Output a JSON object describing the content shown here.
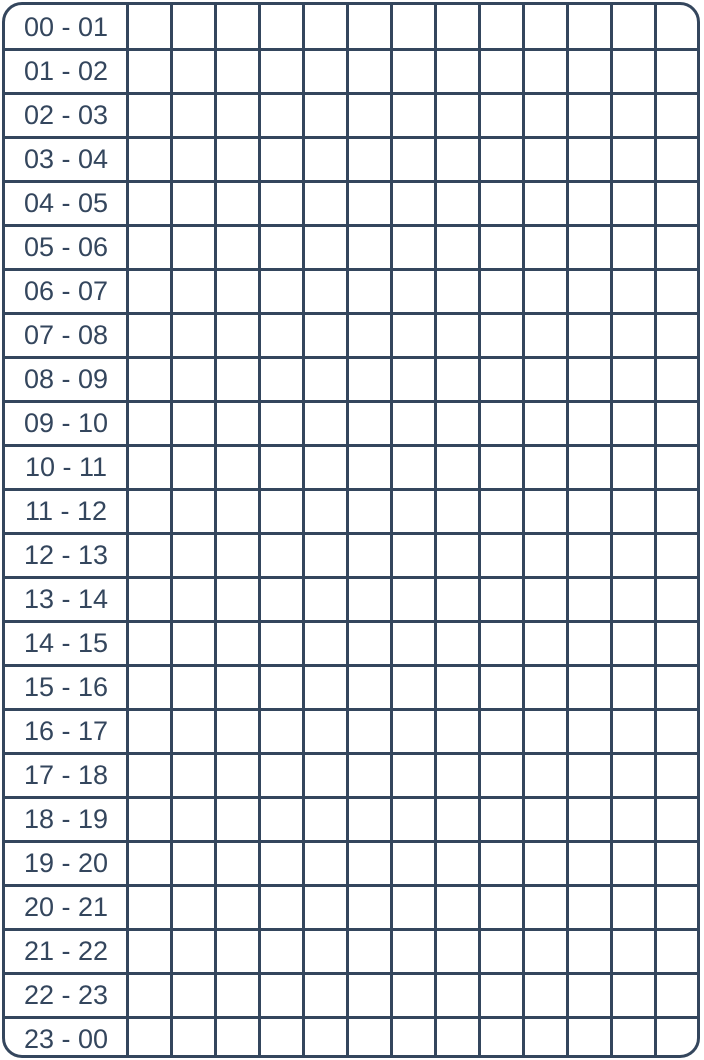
{
  "tracker": {
    "grid_color": "#34465d",
    "hours": [
      {
        "label": "00 - 01"
      },
      {
        "label": "01 - 02"
      },
      {
        "label": "02 - 03"
      },
      {
        "label": "03 - 04"
      },
      {
        "label": "04 - 05"
      },
      {
        "label": "05 - 06"
      },
      {
        "label": "06 - 07"
      },
      {
        "label": "07 - 08"
      },
      {
        "label": "08 - 09"
      },
      {
        "label": "09 - 10"
      },
      {
        "label": "10 - 11"
      },
      {
        "label": "11 - 12"
      },
      {
        "label": "12 - 13"
      },
      {
        "label": "13 - 14"
      },
      {
        "label": "14 - 15"
      },
      {
        "label": "15 - 16"
      },
      {
        "label": "16 - 17"
      },
      {
        "label": "17 - 18"
      },
      {
        "label": "18 - 19"
      },
      {
        "label": "19 - 20"
      },
      {
        "label": "20 - 21"
      },
      {
        "label": "21 - 22"
      },
      {
        "label": "22 - 23"
      },
      {
        "label": "23 - 00"
      }
    ],
    "cells_per_row": 13
  }
}
